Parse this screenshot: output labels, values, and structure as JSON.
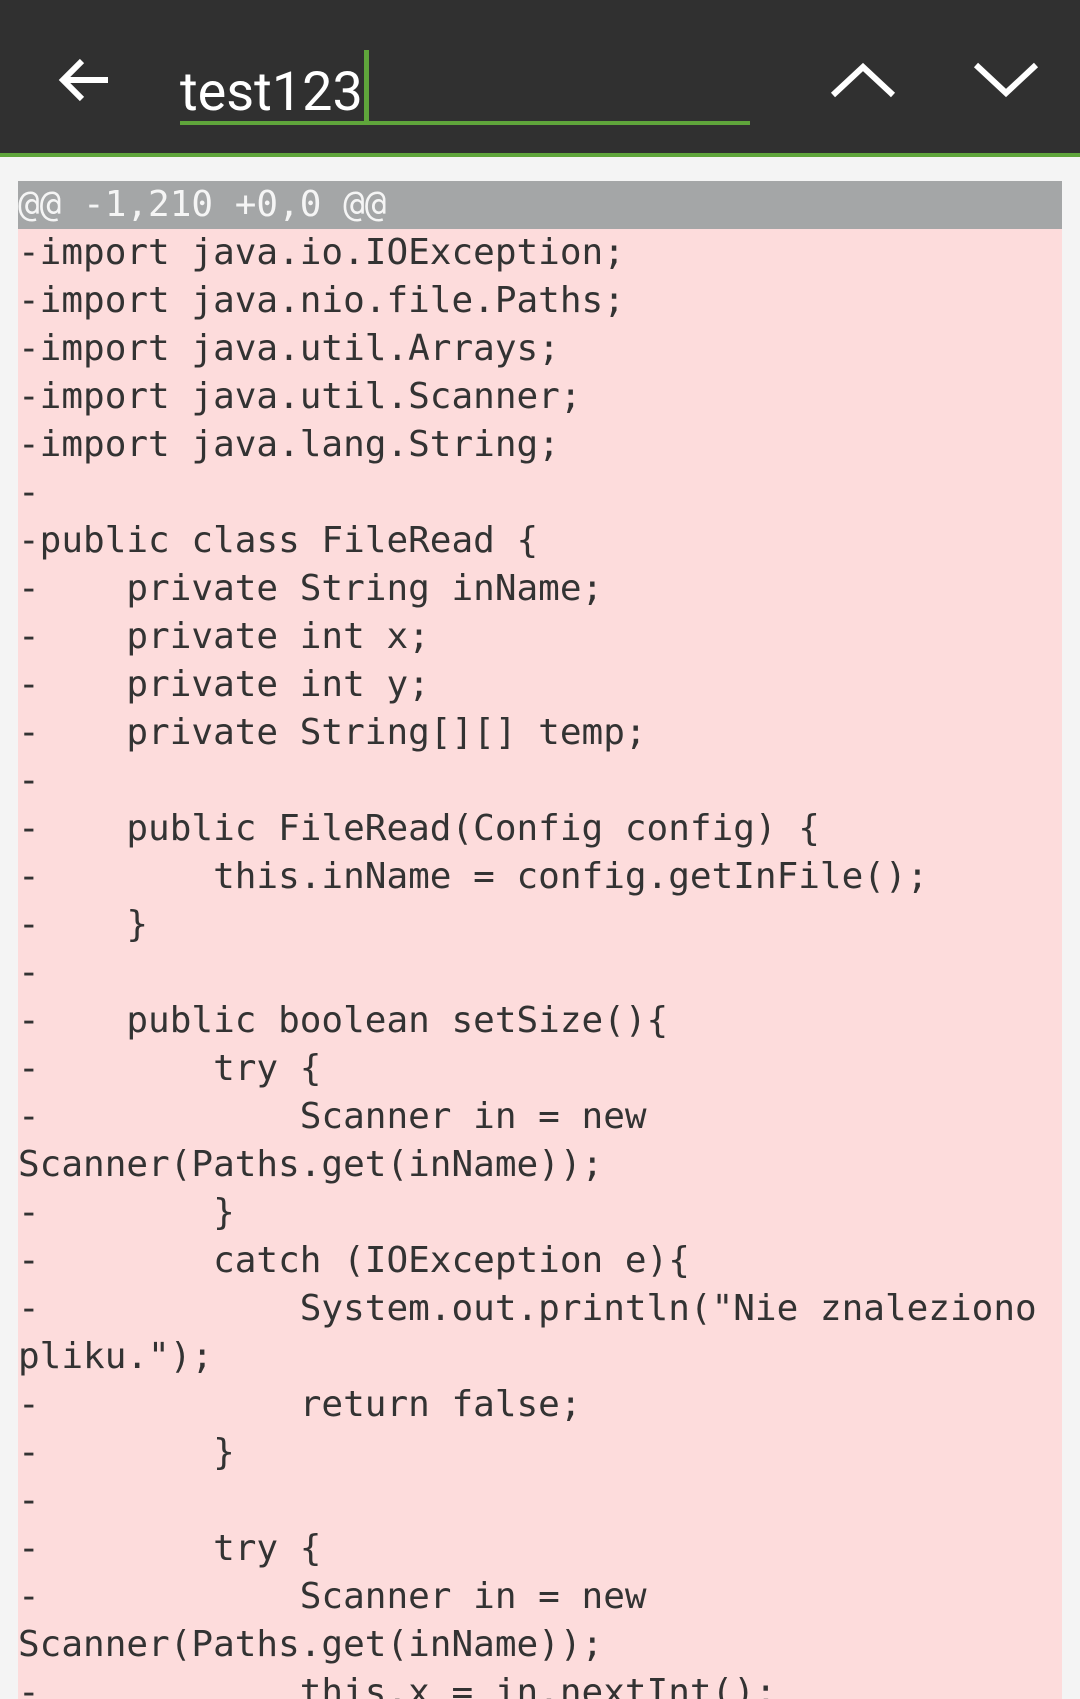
{
  "toolbar": {
    "back_icon": "arrow-left-icon",
    "search_value": "test123",
    "prev_icon": "chevron-up-icon",
    "next_icon": "chevron-down-icon",
    "accent_color": "#5fa53b",
    "background_color": "#303030"
  },
  "diff": {
    "hunk_header": "@@ -1,210 +0,0 @@",
    "removed_line_bg": "#fddcdc",
    "lines": [
      "-import java.io.IOException;",
      "-import java.nio.file.Paths;",
      "-import java.util.Arrays;",
      "-import java.util.Scanner;",
      "-import java.lang.String;",
      "-",
      "-public class FileRead {",
      "-    private String inName;",
      "-    private int x;",
      "-    private int y;",
      "-    private String[][] temp;",
      "-",
      "-    public FileRead(Config config) {",
      "-        this.inName = config.getInFile();",
      "-    }",
      "-",
      "-    public boolean setSize(){",
      "-        try {",
      "-            Scanner in = new",
      "Scanner(Paths.get(inName));",
      "-        }",
      "-        catch (IOException e){",
      "-            System.out.println(\"Nie znaleziono",
      "pliku.\");",
      "-            return false;",
      "-        }",
      "-",
      "-        try {",
      "-            Scanner in = new",
      "Scanner(Paths.get(inName));",
      "-            this.x = in.nextInt();"
    ]
  }
}
